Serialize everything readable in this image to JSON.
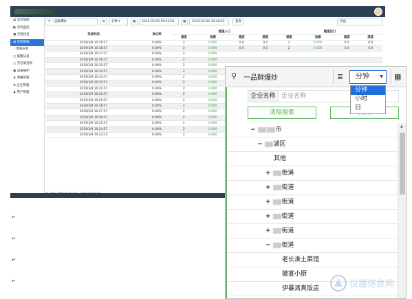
{
  "sidebar": {
    "items": [
      {
        "icon": "map-icon",
        "label": "实时地图",
        "active": false
      },
      {
        "icon": "monitor-icon",
        "label": "实时监控",
        "active": false
      },
      {
        "icon": "rank-icon",
        "label": "污染排名",
        "active": false
      },
      {
        "icon": "history-icon",
        "label": "历史数据",
        "active": true
      },
      {
        "icon": "chart-icon",
        "label": "数据分析",
        "active": false
      },
      {
        "icon": "doc-icon",
        "label": "报警记录",
        "active": false
      },
      {
        "icon": "doc-icon",
        "label": "无记录查询",
        "active": false
      },
      {
        "icon": "device-icon",
        "label": "设备维护",
        "active": false
      },
      {
        "icon": "user-icon",
        "label": "清餐管理",
        "active": false
      },
      {
        "icon": "gear-icon",
        "label": "企业管理",
        "active": false
      },
      {
        "icon": "user-icon",
        "label": "用户管理",
        "active": false
      }
    ]
  },
  "filter": {
    "shop": "一品鲜爆炒",
    "unit": "分钟",
    "start": "2019-03-09 09:40:51",
    "end": "2019-03-09 10:40:51",
    "query": "查询",
    "export": "导出"
  },
  "table": {
    "headers": {
      "time": "采样时间",
      "rate": "净化率",
      "inlet": "烟道入口",
      "outlet": "烟道出口",
      "cols": [
        "湿度",
        "油烟",
        "温度",
        "湿度",
        "湿度",
        "油烟",
        "温度",
        "湿度"
      ]
    },
    "rows": [
      [
        "2019/3/9 10:39:57",
        "0.00%",
        "2",
        "0.000",
        "0.0",
        "0.0",
        "2",
        "0.000",
        "0.0",
        "0.0"
      ],
      [
        "2019/3/9 10:38:57",
        "0.00%",
        "2",
        "0.000",
        "0.0",
        "0.0",
        "2",
        "0.000",
        "0.0",
        "0.0"
      ],
      [
        "2019/3/9 10:37:57",
        "0.00%",
        "2",
        "0.000",
        "",
        "",
        "",
        "",
        "",
        ""
      ],
      [
        "2019/3/9 10:36:57",
        "0.00%",
        "2",
        "0.000",
        "",
        "",
        "",
        "",
        "",
        ""
      ],
      [
        "2019/3/9 10:35:57",
        "0.00%",
        "2",
        "0.000",
        "",
        "",
        "",
        "",
        "",
        ""
      ],
      [
        "2019/3/9 10:34:57",
        "0.00%",
        "2",
        "0.000",
        "",
        "",
        "",
        "",
        "",
        ""
      ],
      [
        "2019/3/9 10:33:57",
        "0.00%",
        "2",
        "0.000",
        "",
        "",
        "",
        "",
        "",
        ""
      ],
      [
        "2019/3/9 10:32:53",
        "0.00%",
        "2",
        "0.000",
        "",
        "",
        "",
        "",
        "",
        ""
      ],
      [
        "2019/3/9 10:31:57",
        "0.00%",
        "2",
        "0.000",
        "",
        "",
        "",
        "",
        "",
        ""
      ],
      [
        "2019/3/9 10:30:57",
        "0.00%",
        "2",
        "0.000",
        "",
        "",
        "",
        "",
        "",
        ""
      ],
      [
        "2019/3/9 10:29:57",
        "0.00%",
        "2",
        "0.000",
        "",
        "",
        "",
        "",
        "",
        ""
      ],
      [
        "2019/3/9 10:28:57",
        "0.00%",
        "2",
        "0.000",
        "",
        "",
        "",
        "",
        "",
        ""
      ],
      [
        "2019/3/9 10:27:57",
        "0.00%",
        "2",
        "0.000",
        "",
        "",
        "",
        "",
        "",
        ""
      ],
      [
        "2019/3/9 10:26:57",
        "0.00%",
        "2",
        "0.000",
        "",
        "",
        "",
        "",
        "",
        ""
      ],
      [
        "2019/3/9 10:25:57",
        "0.00%",
        "2",
        "0.000",
        "",
        "",
        "",
        "",
        "",
        ""
      ],
      [
        "2019/3/9 10:24:57",
        "0.00%",
        "2",
        "0.000",
        "",
        "",
        "",
        "",
        "",
        ""
      ],
      [
        "2019/3/9 10:23:53",
        "0.00%",
        "2",
        "0.000",
        "",
        "",
        "",
        "",
        "",
        ""
      ]
    ],
    "pager": "显示第 1 到第 10 条记录，总共 10 条记录"
  },
  "popup": {
    "shop": "一品鲜爆炒",
    "unit_selected": "分钟",
    "unit_options": [
      "分钟",
      "小时",
      "日"
    ],
    "query_label": "企业名称",
    "query_placeholder": "企业名称",
    "clear_btn": "清除搜索",
    "close_btn": "关闭",
    "tree": [
      {
        "sym": "−",
        "indent": 34,
        "blur": 2,
        "text": "市"
      },
      {
        "sym": "−",
        "indent": 44,
        "blur": 1,
        "text": "湖区"
      },
      {
        "sym": "",
        "indent": 68,
        "blur": 0,
        "text": "其他"
      },
      {
        "sym": "+",
        "indent": 56,
        "blur": 1,
        "text": "街道"
      },
      {
        "sym": "+",
        "indent": 56,
        "blur": 1,
        "text": "街道"
      },
      {
        "sym": "+",
        "indent": 56,
        "blur": 1,
        "text": "街道"
      },
      {
        "sym": "+",
        "indent": 56,
        "blur": 1,
        "text": "街道"
      },
      {
        "sym": "+",
        "indent": 56,
        "blur": 1,
        "text": "街道"
      },
      {
        "sym": "−",
        "indent": 56,
        "blur": 1,
        "text": "街道"
      },
      {
        "sym": "",
        "indent": 80,
        "blur": 0,
        "text": "老长淮土菜馆"
      },
      {
        "sym": "",
        "indent": 80,
        "blur": 0,
        "text": "徽宴小厨"
      },
      {
        "sym": "",
        "indent": 80,
        "blur": 0,
        "text": "伊暴清真饭店"
      }
    ]
  },
  "doc_marks": [
    "↵",
    "↵",
    "↵",
    "↵"
  ],
  "watermark": "仪器信息网"
}
